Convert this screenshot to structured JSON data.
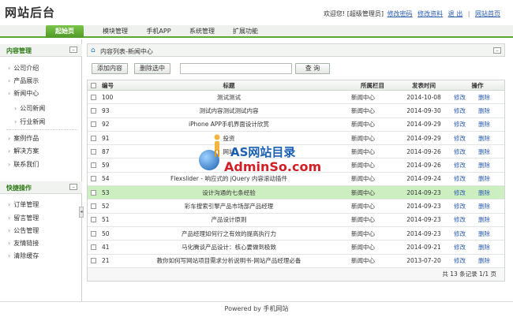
{
  "header": {
    "logo": "网站后台",
    "welcome": "欢迎您! [超级管理员]",
    "links": [
      "修改密码",
      "修改资料",
      "退 出",
      "网站首页"
    ]
  },
  "nav": {
    "tabs": [
      "起始页",
      "模块管理",
      "手机APP",
      "系统管理",
      "扩展功能"
    ],
    "active": "起始页"
  },
  "sidebar": {
    "content_title": "内容管理",
    "content_items": [
      "公司介绍",
      "产品展示",
      "新闻中心",
      "公司新闻",
      "行业新闻",
      "案例作品",
      "解决方案",
      "联系我们"
    ],
    "quick_title": "快捷操作",
    "quick_items": [
      "订单管理",
      "留言管理",
      "公告管理",
      "友情链接",
      "清除缓存"
    ]
  },
  "main": {
    "breadcrumb": "内容列表-新闻中心",
    "buttons": {
      "add": "添加内容",
      "delete_selected": "删除选中",
      "search": "查 询"
    },
    "search_value": "",
    "table": {
      "headers": [
        "编号",
        "标题",
        "所属栏目",
        "发表时间",
        "操作"
      ],
      "edit_label": "修改",
      "delete_label": "删除",
      "rows": [
        {
          "id": "100",
          "title": "测试测试",
          "category": "新闻中心",
          "date": "2014-10-08"
        },
        {
          "id": "93",
          "title": "测试内容测试测试内容",
          "category": "新闻中心",
          "date": "2014-09-30"
        },
        {
          "id": "92",
          "title": "iPhone APP手机界面设计欣赏",
          "category": "新闻中心",
          "date": "2014-09-29"
        },
        {
          "id": "91",
          "title": "投资",
          "category": "新闻中心",
          "date": "2014-09-29"
        },
        {
          "id": "87",
          "title": "网站",
          "category": "新闻中心",
          "date": "2014-09-26"
        },
        {
          "id": "59",
          "title": "",
          "category": "新闻中心",
          "date": "2014-09-26"
        },
        {
          "id": "54",
          "title": "Flexslider - 响应式的 jQuery 内容滚动插件",
          "category": "新闻中心",
          "date": "2014-09-24"
        },
        {
          "id": "53",
          "title": "设计沟通的七条经验",
          "category": "新闻中心",
          "date": "2014-09-23"
        },
        {
          "id": "52",
          "title": "彩车搜索引擎产品市场部产品经理",
          "category": "新闻中心",
          "date": "2014-09-23"
        },
        {
          "id": "51",
          "title": "产品设计原则",
          "category": "新闻中心",
          "date": "2014-09-23"
        },
        {
          "id": "50",
          "title": "产品经理如何行之有效的提高执行力",
          "category": "新闻中心",
          "date": "2014-09-23"
        },
        {
          "id": "41",
          "title": "马化腾谈产品设计：核心要做到极致",
          "category": "新闻中心",
          "date": "2014-09-21"
        },
        {
          "id": "21",
          "title": "教你如何写网站项目需求分析说明书-网站产品经理必备",
          "category": "新闻中心",
          "date": "2013-07-20"
        }
      ],
      "highlighted_row": 7,
      "pagination": "共 13 条记录 1/1 页"
    }
  },
  "watermark": {
    "line1": "AS网站目录",
    "line2": "AdminSo.com"
  },
  "footer": "Powered by 手机网站",
  "colors": {
    "accent": "#5aa830",
    "link": "#2a5db0",
    "highlight": "#cdeec0"
  }
}
